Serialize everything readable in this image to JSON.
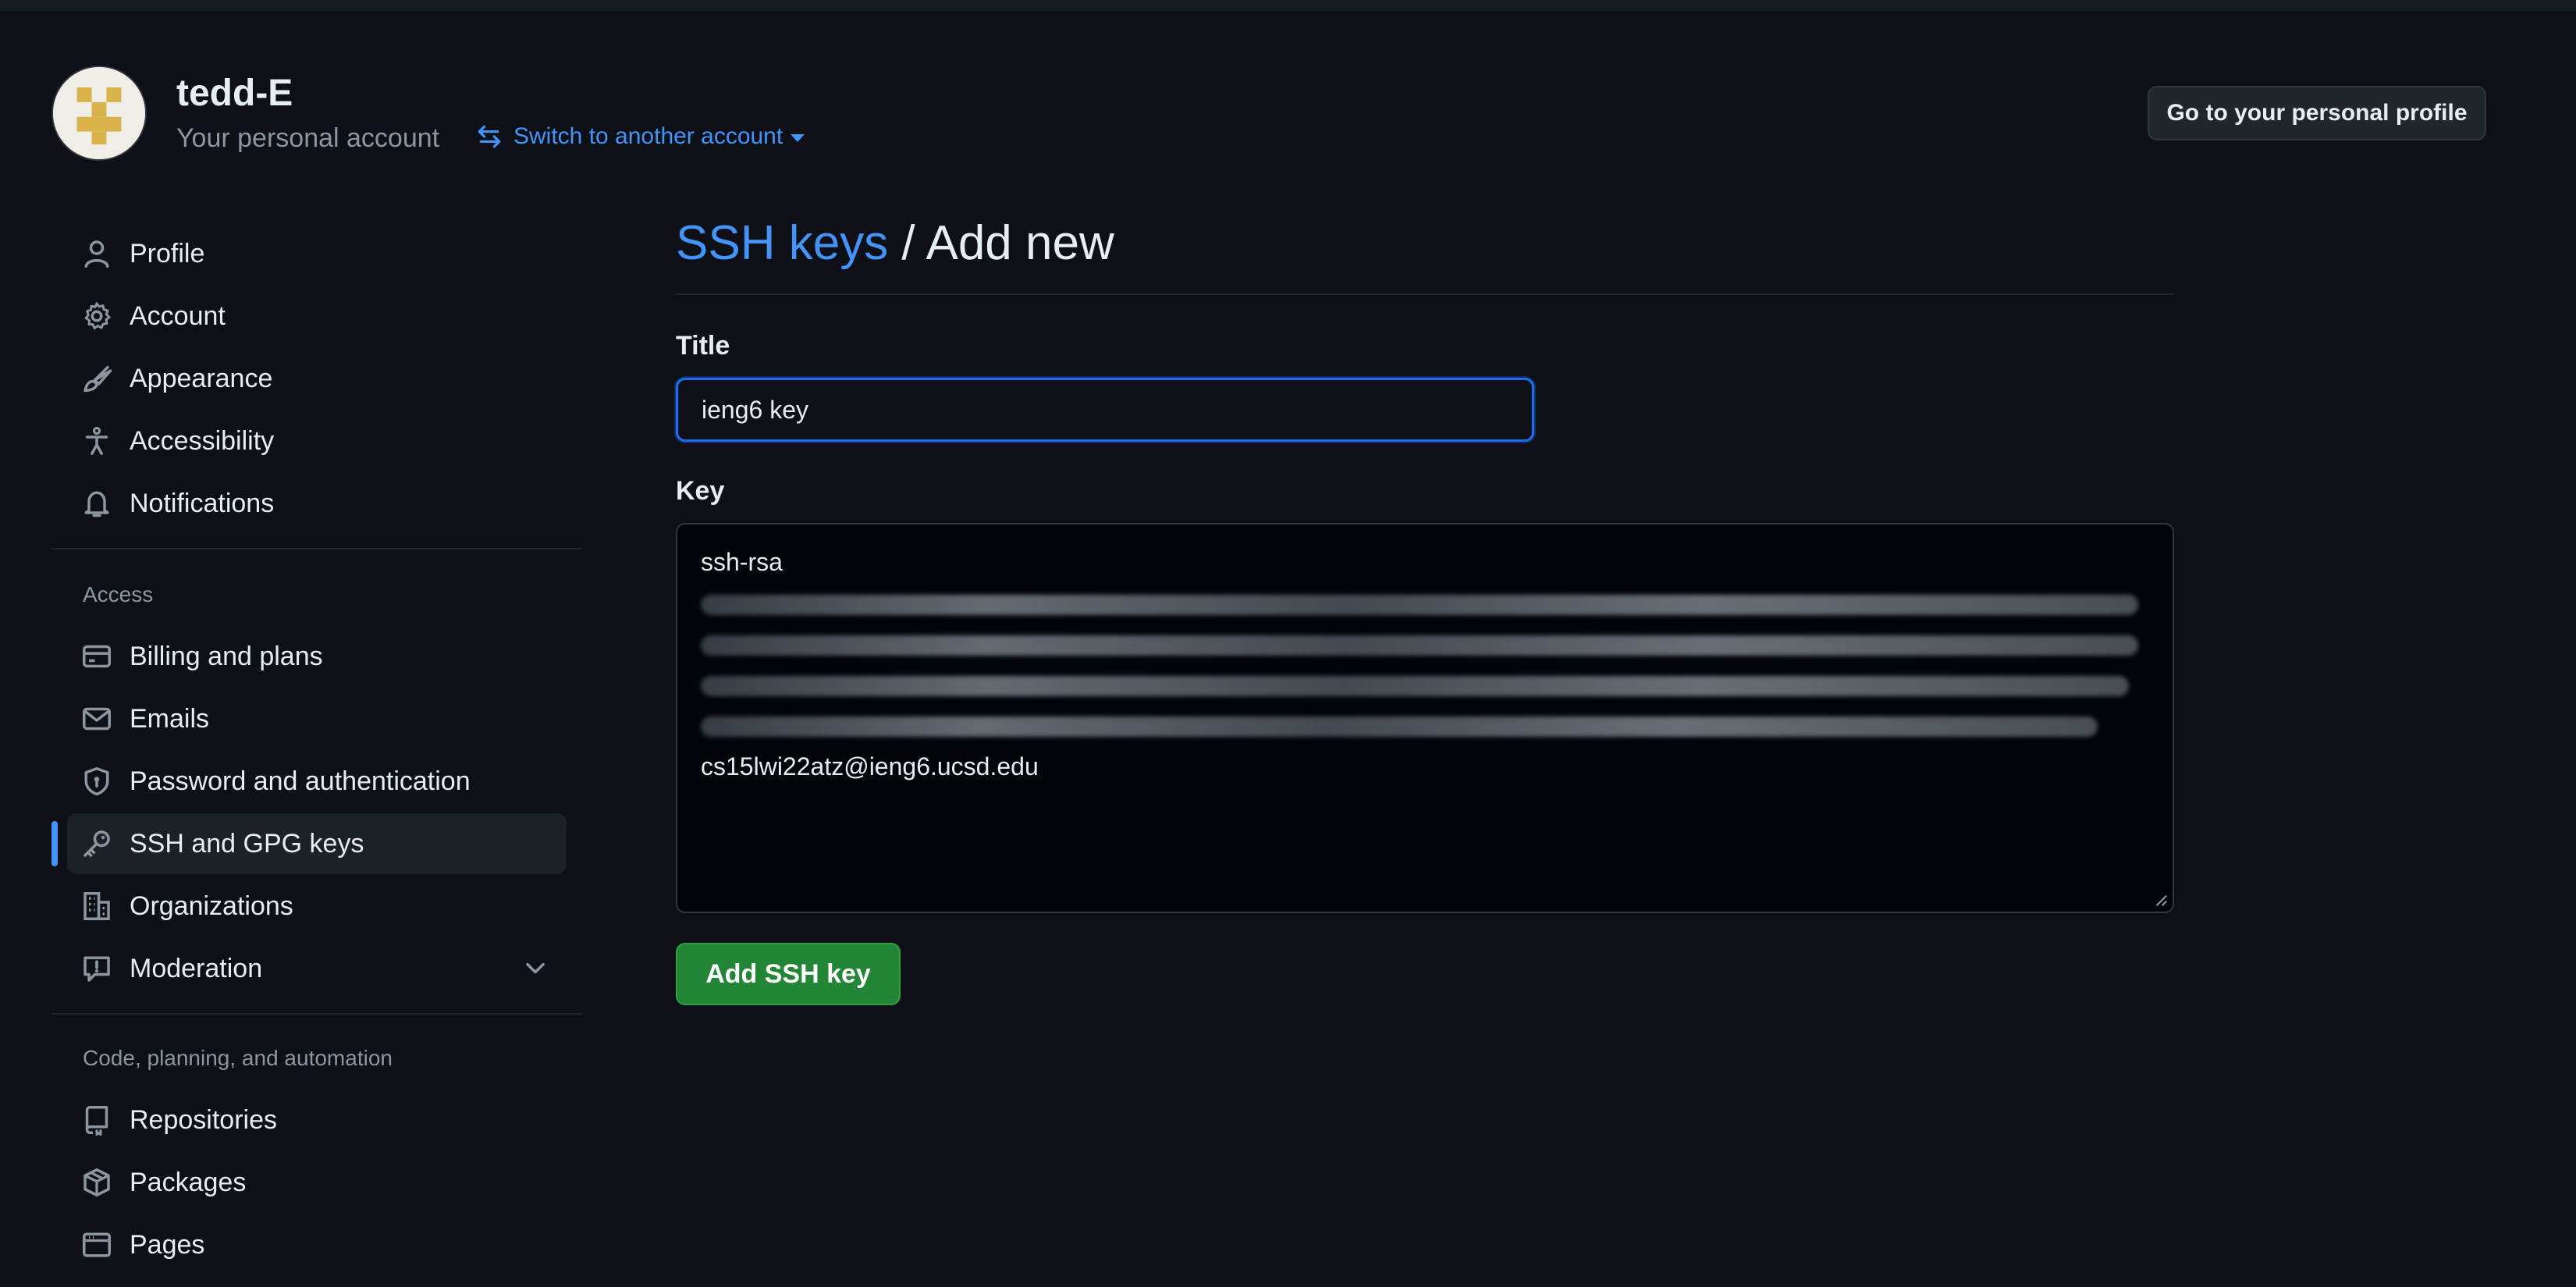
{
  "account": {
    "name": "tedd-E",
    "subtitle": "Your personal account",
    "switch_label": "Switch to another account",
    "profile_button": "Go to your personal profile"
  },
  "sidebar": {
    "items": [
      {
        "label": "Profile",
        "icon": "person-icon"
      },
      {
        "label": "Account",
        "icon": "gear-icon"
      },
      {
        "label": "Appearance",
        "icon": "paintbrush-icon"
      },
      {
        "label": "Accessibility",
        "icon": "accessibility-icon"
      },
      {
        "label": "Notifications",
        "icon": "bell-icon"
      }
    ],
    "access_heading": "Access",
    "access_items": [
      {
        "label": "Billing and plans",
        "icon": "credit-card-icon"
      },
      {
        "label": "Emails",
        "icon": "mail-icon"
      },
      {
        "label": "Password and authentication",
        "icon": "shield-lock-icon"
      },
      {
        "label": "SSH and GPG keys",
        "icon": "key-icon",
        "active": true
      },
      {
        "label": "Organizations",
        "icon": "organization-icon"
      },
      {
        "label": "Moderation",
        "icon": "report-icon"
      }
    ],
    "code_heading": "Code, planning, and automation",
    "code_items": [
      {
        "label": "Repositories",
        "icon": "repo-icon"
      },
      {
        "label": "Packages",
        "icon": "package-icon"
      },
      {
        "label": "Pages",
        "icon": "browser-icon"
      }
    ]
  },
  "main": {
    "breadcrumb_link": "SSH keys",
    "breadcrumb_rest": " / Add new",
    "title_label": "Title",
    "title_value": "ieng6 key",
    "key_label": "Key",
    "key_first_line": "ssh-rsa",
    "key_last_line": "cs15lwi22atz@ieng6.ucsd.edu",
    "submit_label": "Add SSH key"
  },
  "colors": {
    "background": "#0d1117",
    "accent": "#4493f8",
    "submit": "#238636"
  }
}
